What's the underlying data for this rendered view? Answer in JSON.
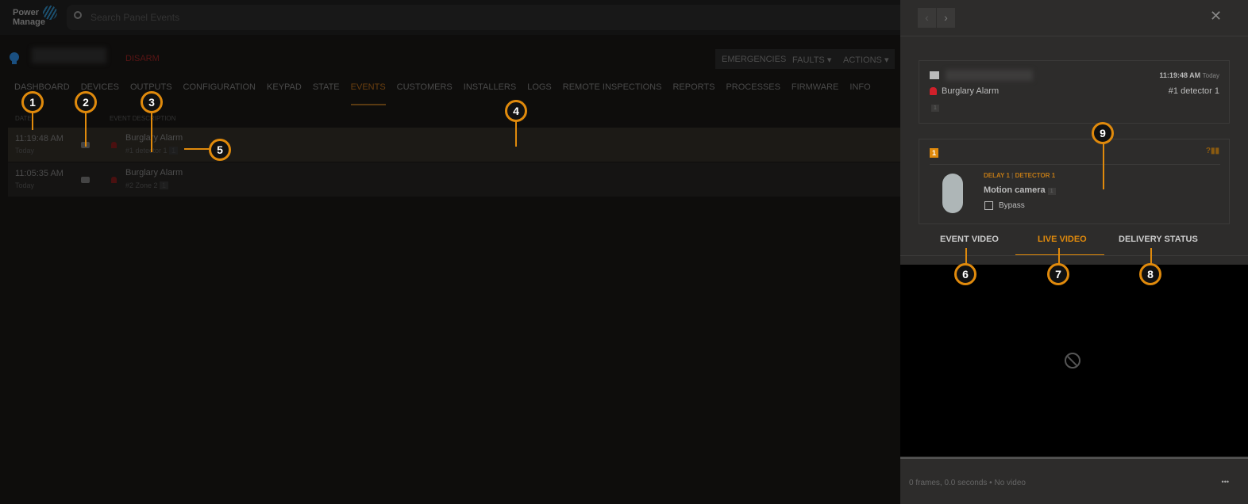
{
  "app": {
    "logo": "Power Manage",
    "search_placeholder": "Search Panel Events"
  },
  "panel_header": {
    "disarm": "DISARM",
    "buttons": [
      "EMERGENCIES",
      "FAULTS",
      "ACTIONS"
    ]
  },
  "tabs": [
    "DASHBOARD",
    "DEVICES",
    "OUTPUTS",
    "CONFIGURATION",
    "KEYPAD",
    "STATE",
    "EVENTS",
    "CUSTOMERS",
    "INSTALLERS",
    "LOGS",
    "REMOTE INSPECTIONS",
    "REPORTS",
    "PROCESSES",
    "FIRMWARE",
    "INFO"
  ],
  "active_tab": "EVENTS",
  "columns": {
    "date": "DATE",
    "desc": "EVENT DESCRIPTION"
  },
  "events": [
    {
      "time": "11:19:48 AM",
      "day": "Today",
      "title": "Burglary Alarm",
      "zone": "#1 detector 1",
      "badge": "1"
    },
    {
      "time": "11:05:35 AM",
      "day": "Today",
      "title": "Burglary Alarm",
      "zone": "#2 Zone 2",
      "badge": "1"
    }
  ],
  "detail": {
    "time": "11:19:48 AM",
    "day": "Today",
    "title": "Burglary Alarm",
    "zone": "#1 detector 1",
    "badge": "1",
    "device": {
      "number": "1",
      "partition": "DELAY 1",
      "name_tag": "DETECTOR 1",
      "name": "Motion camera",
      "badge": "1",
      "bypass": "Bypass",
      "signal": "?"
    },
    "tabs": [
      "EVENT VIDEO",
      "LIVE VIDEO",
      "DELIVERY STATUS"
    ],
    "active_tab": "LIVE VIDEO",
    "footer": {
      "frames": "0 frames, 0.0 seconds",
      "sep": "•",
      "status": "No video",
      "more": "•••"
    }
  },
  "callouts": [
    "1",
    "2",
    "3",
    "4",
    "5",
    "6",
    "7",
    "8",
    "9"
  ],
  "colors": {
    "accent": "#e08a0c",
    "alarm": "#d0202a"
  }
}
